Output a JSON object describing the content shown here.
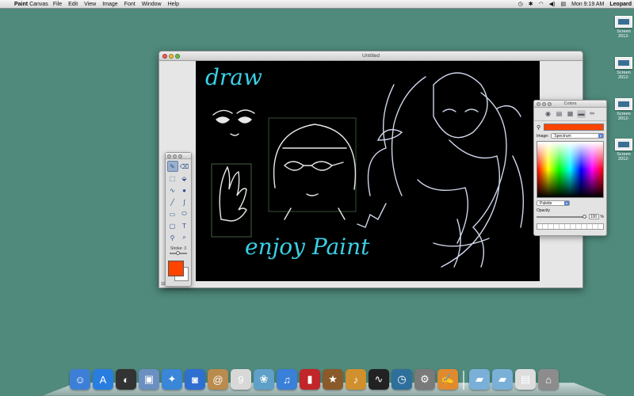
{
  "menubar": {
    "apple": "",
    "app_name_bold": "Paint",
    "app_name_thin": " Canvas",
    "menus": [
      "File",
      "Edit",
      "View",
      "Image",
      "Font",
      "Window",
      "Help"
    ],
    "clock": "Mon 9:19 AM",
    "user": "Leopard",
    "status_icons": [
      "time-machine-icon",
      "bluetooth-icon",
      "wifi-icon",
      "volume-icon",
      "flag-icon"
    ]
  },
  "desktop": {
    "icons": [
      {
        "label": "Screen 2012-"
      },
      {
        "label": "Screen 2012-"
      },
      {
        "label": "Screen 2012-"
      },
      {
        "label": "Screen 2012-"
      }
    ]
  },
  "window": {
    "title": "Untitled",
    "zoom": "100"
  },
  "canvas": {
    "text_draw": "draw",
    "text_enjoy": "enjoy Paint",
    "text_color": "#39d0e6",
    "background": "#000000"
  },
  "tools": {
    "buttons": [
      "pencil-icon",
      "eraser-icon",
      "marquee-icon",
      "bucket-icon",
      "lasso-icon",
      "bomb-icon",
      "line-icon",
      "curve-icon",
      "rectangle-icon",
      "ellipse-icon",
      "rounded-rect-icon",
      "text-icon",
      "eyedropper-icon",
      "zoom-icon"
    ],
    "glyphs": [
      "✎",
      "⌫",
      "⬚",
      "⬙",
      "∿",
      "●",
      "╱",
      "∫",
      "▭",
      "⬭",
      "▢",
      "T",
      "⚲",
      "⌕"
    ],
    "stroke_label": "Stroke: 3",
    "stroke": 3,
    "foreground": "#ff4400",
    "background": "#ffffff"
  },
  "colors_panel": {
    "title": "Colors",
    "modes": [
      "color-wheel-icon",
      "sliders-icon",
      "palettes-icon",
      "spectrum-icon",
      "crayons-icon"
    ],
    "mode_glyphs": [
      "◉",
      "▤",
      "▦",
      "▬",
      "✏"
    ],
    "current_color": "#ff4400",
    "image_label": "Image:",
    "image_value": "Spectrum",
    "palette_value": "Palette",
    "opacity_label": "Opacity",
    "opacity_value": "100",
    "opacity_unit": "%",
    "opacity": 100
  },
  "dock": {
    "items": [
      {
        "name": "finder-icon",
        "glyph": "☺",
        "color": "#3d7fd6"
      },
      {
        "name": "app-store-icon",
        "glyph": "A",
        "color": "#2a7de0"
      },
      {
        "name": "dashboard-icon",
        "glyph": "◐",
        "color": "#333333"
      },
      {
        "name": "preview-icon",
        "glyph": "▣",
        "color": "#6a8fc0"
      },
      {
        "name": "safari-icon",
        "glyph": "✦",
        "color": "#3a86d8"
      },
      {
        "name": "facetime-icon",
        "glyph": "◙",
        "color": "#2f6fd0"
      },
      {
        "name": "contacts-icon",
        "glyph": "@",
        "color": "#b98b4e"
      },
      {
        "name": "calendar-icon",
        "glyph": "9",
        "color": "#d8d8d8"
      },
      {
        "name": "iphoto-icon",
        "glyph": "❀",
        "color": "#5ea0c8"
      },
      {
        "name": "itunes-icon",
        "glyph": "♫",
        "color": "#3a7fd8"
      },
      {
        "name": "photo-booth-icon",
        "glyph": "▮",
        "color": "#c0262a"
      },
      {
        "name": "imovie-icon",
        "glyph": "★",
        "color": "#8a5a2a"
      },
      {
        "name": "garageband-icon",
        "glyph": "♪",
        "color": "#d0902e"
      },
      {
        "name": "activity-monitor-icon",
        "glyph": "∿",
        "color": "#222222"
      },
      {
        "name": "time-machine-dock-icon",
        "glyph": "◷",
        "color": "#2e6f9c"
      },
      {
        "name": "system-preferences-icon",
        "glyph": "⚙",
        "color": "#7a7a7a"
      },
      {
        "name": "paint-canvas-icon",
        "glyph": "✍",
        "color": "#e08a30"
      },
      {
        "name": "applications-folder-icon",
        "glyph": "▰",
        "color": "#7ab0d8"
      },
      {
        "name": "documents-folder-icon",
        "glyph": "▰",
        "color": "#7ab0d8"
      },
      {
        "name": "downloads-stack-icon",
        "glyph": "▤",
        "color": "#dddddd"
      },
      {
        "name": "trash-icon",
        "glyph": "⌂",
        "color": "#8c8c8c"
      }
    ]
  }
}
